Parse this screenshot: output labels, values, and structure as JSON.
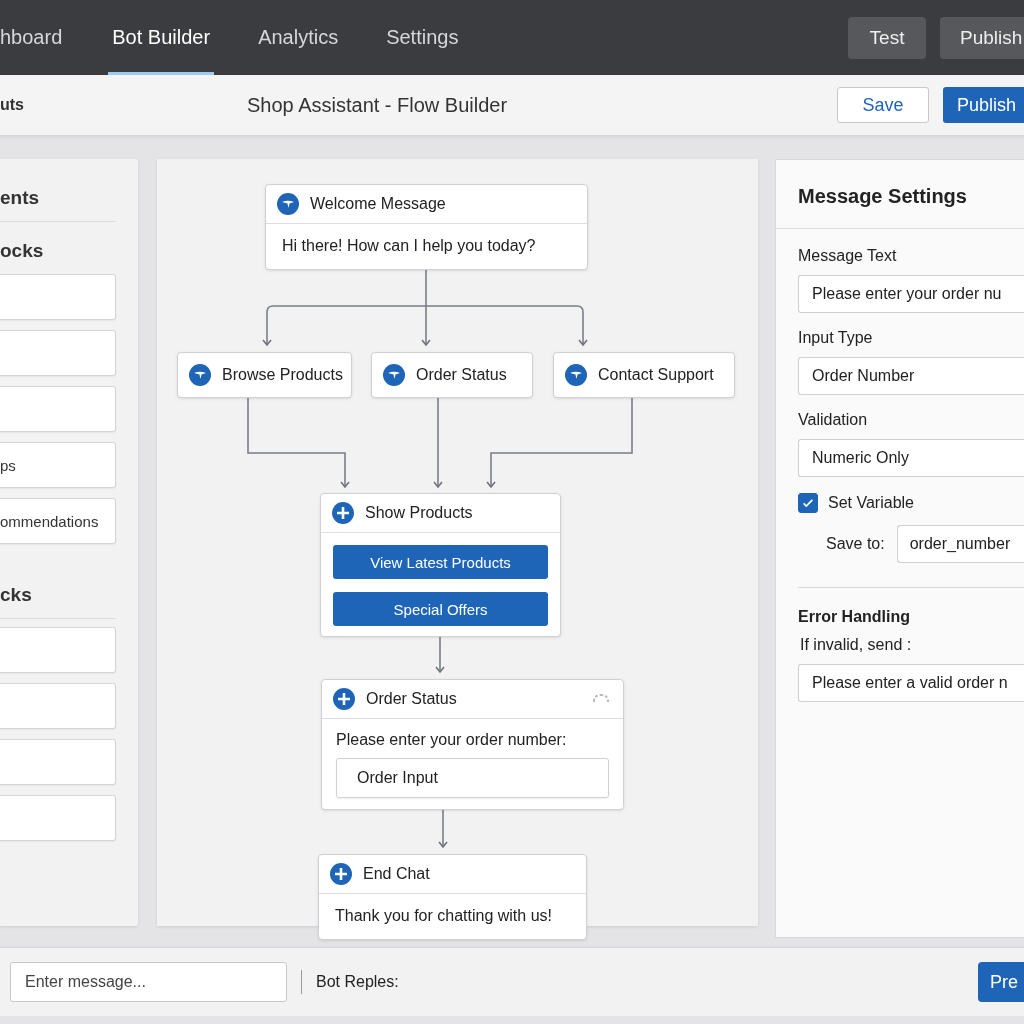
{
  "top_nav": {
    "tabs": [
      {
        "label": "hboard",
        "selected": false
      },
      {
        "label": "Bot Builder",
        "selected": true
      },
      {
        "label": "Analytics",
        "selected": false
      },
      {
        "label": "Settings",
        "selected": false
      }
    ],
    "buttons": [
      "Test",
      "Publish"
    ]
  },
  "header": {
    "section": "uts",
    "title": "Shop Assistant - Flow Builder",
    "buttons": [
      {
        "label": "Save",
        "kind": "secondary"
      },
      {
        "label": "Publish",
        "kind": "primary"
      }
    ]
  },
  "sidebar": {
    "title": "ents",
    "groups": [
      {
        "title": "ocks",
        "items": [
          {
            "kind": "blank"
          },
          {
            "kind": "blank"
          },
          {
            "kind": "blank"
          },
          {
            "kind": "text",
            "label": "ps"
          },
          {
            "kind": "text",
            "label": "ommendations"
          }
        ]
      },
      {
        "title": "cks",
        "items": [
          {
            "kind": "blank"
          },
          {
            "kind": "blank"
          },
          {
            "kind": "blank"
          },
          {
            "kind": "blank"
          }
        ]
      }
    ]
  },
  "flow": {
    "nodes": [
      {
        "kind": "start",
        "title": "Welcome Message",
        "text": "Hi there! How can I help you today?"
      },
      {
        "kind": "option",
        "title": "Browse Products"
      },
      {
        "kind": "option",
        "title": "Order Status"
      },
      {
        "kind": "option",
        "title": "Contact Support"
      },
      {
        "kind": "buttons",
        "title": "Show Products",
        "buttons": [
          "View Latest Products",
          "Special Offers"
        ]
      },
      {
        "kind": "input",
        "title": "Order Status",
        "text": "Please enter your order number:",
        "field": "Order Input"
      },
      {
        "kind": "end",
        "title": "End Chat",
        "text": "Thank you for chatting with us!"
      }
    ]
  },
  "settings": {
    "title": "Message Settings",
    "fields": [
      {
        "label": "Message Text",
        "value": "Please enter your order nu"
      },
      {
        "label": "Input Type",
        "value": "Order Number"
      },
      {
        "label": "Validation",
        "value": "Numeric Only"
      }
    ],
    "set_variable": {
      "label": "Set Variable",
      "checked": true
    },
    "save_to": {
      "label": "Save to:",
      "value": "order_number"
    },
    "error": {
      "title": "Error Handling",
      "label": "If invalid, send :",
      "value": "Please enter a valid order n"
    }
  },
  "bottom": {
    "placeholder": "Enter message...",
    "label": "Bot Reples:",
    "button": "Pre"
  }
}
